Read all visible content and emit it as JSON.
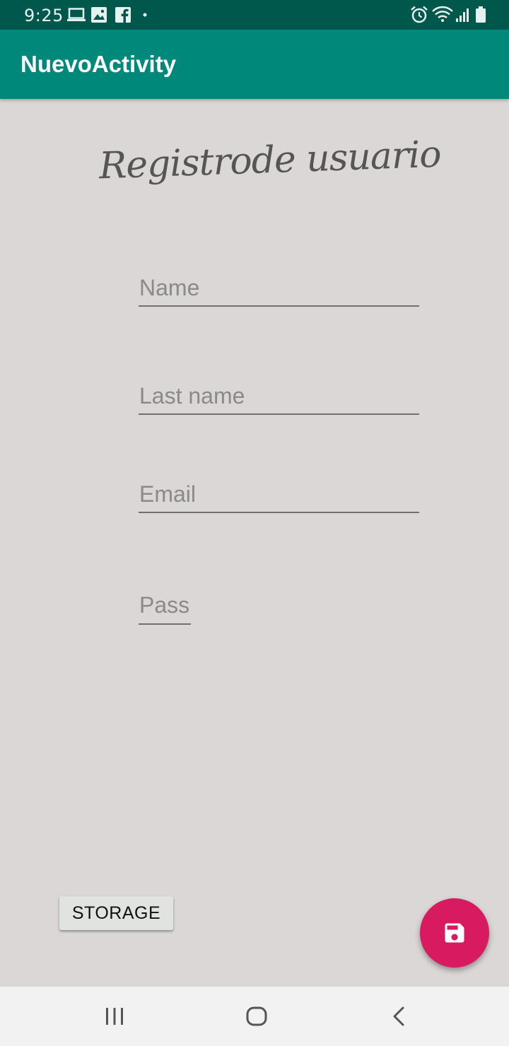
{
  "status_bar": {
    "time": "9:25",
    "left_icons": [
      "laptop-icon",
      "image-icon",
      "facebook-icon",
      "dot-icon"
    ],
    "right_icons": [
      "alarm-icon",
      "wifi-icon",
      "signal-icon",
      "battery-icon"
    ]
  },
  "app_bar": {
    "title": "NuevoActivity"
  },
  "form": {
    "title": "Registrode usuario",
    "fields": [
      {
        "placeholder": "Name",
        "value": ""
      },
      {
        "placeholder": "Last name",
        "value": ""
      },
      {
        "placeholder": "Email",
        "value": ""
      },
      {
        "placeholder": "Pass",
        "value": ""
      }
    ]
  },
  "buttons": {
    "storage_label": "STORAGE",
    "fab_icon": "save-icon"
  },
  "nav_bar": {
    "icons": [
      "recents-icon",
      "home-icon",
      "back-icon"
    ]
  },
  "colors": {
    "status_bar": "#00574c",
    "app_bar": "#00897b",
    "background": "#dad7d6",
    "fab": "#d81b60"
  }
}
